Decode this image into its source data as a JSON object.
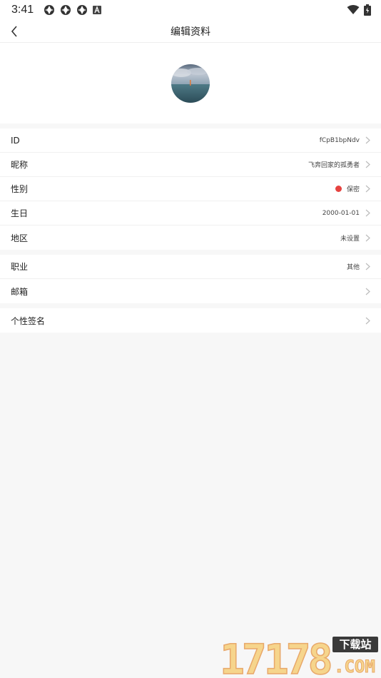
{
  "status_bar": {
    "time": "3:41",
    "notification_icons": [
      "app-notification-icon",
      "app-notification-icon",
      "app-notification-icon",
      "text-a-icon"
    ],
    "wifi_icon": "wifi-icon",
    "battery_icon": "battery-charging-icon"
  },
  "nav": {
    "back_icon": "chevron-left-icon",
    "title": "编辑资料"
  },
  "profile": {
    "avatar": "avatar-image"
  },
  "groups": [
    {
      "rows": [
        {
          "label": "ID",
          "value": "fCpB1bpNdv"
        },
        {
          "label": "昵称",
          "value": "飞奔回家的孤勇者"
        },
        {
          "label": "性别",
          "value": "保密",
          "indicator_color": "#e64340"
        },
        {
          "label": "生日",
          "value": "2000-01-01"
        },
        {
          "label": "地区",
          "value": "未设置"
        }
      ]
    },
    {
      "rows": [
        {
          "label": "职业",
          "value": "其他"
        },
        {
          "label": "邮箱",
          "value": ""
        }
      ]
    },
    {
      "rows": [
        {
          "label": "个性签名",
          "value": ""
        }
      ]
    }
  ],
  "watermark": {
    "number": "17178",
    "tag": "下载站",
    "domain": ".COM"
  },
  "colors": {
    "background": "#f7f7f7",
    "surface": "#ffffff",
    "gender_dot": "#e64340",
    "chevron": "#bbbbbb"
  }
}
